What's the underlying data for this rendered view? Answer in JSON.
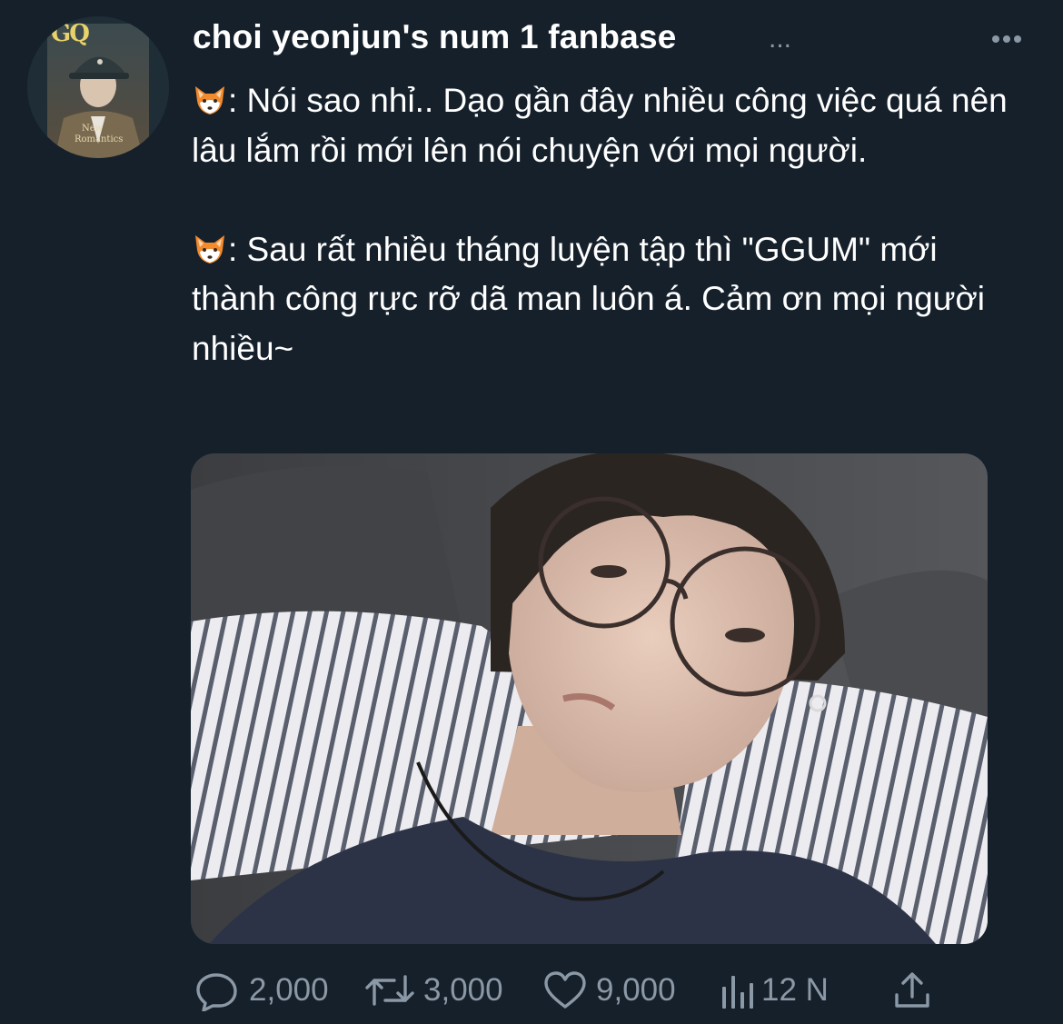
{
  "author": {
    "display_name": "choi yeonjun's num 1 fanbase",
    "name_overflow": "...",
    "avatar_text": {
      "badge": "GQ",
      "cover_line1": "New",
      "cover_line2": "Romantics"
    }
  },
  "tweet": {
    "paragraphs": [
      {
        "emoji": "fox-face-emoji",
        "text": ": Nói sao nhỉ.. Dạo gần đây nhiều công việc quá nên lâu lắm rồi mới lên nói chuyện với mọi người."
      },
      {
        "emoji": "fox-face-emoji",
        "text": ": Sau rất nhiều tháng luyện tập thì \"GGUM\" mới thành công rực rỡ dã man luôn á. Cảm ơn mọi người nhiều~"
      }
    ]
  },
  "media": {
    "type": "photo"
  },
  "actions": {
    "reply_count": "2,000",
    "retweet_count": "3,000",
    "like_count": "9,000",
    "views_count": "12 N"
  },
  "icons": {
    "more": "more-dots-icon",
    "reply": "reply-icon",
    "retweet": "retweet-icon",
    "like": "heart-icon",
    "views": "views-icon",
    "share": "share-icon"
  },
  "colors": {
    "background": "#15202b",
    "text_primary": "#ffffff",
    "text_secondary": "#8b98a5"
  }
}
